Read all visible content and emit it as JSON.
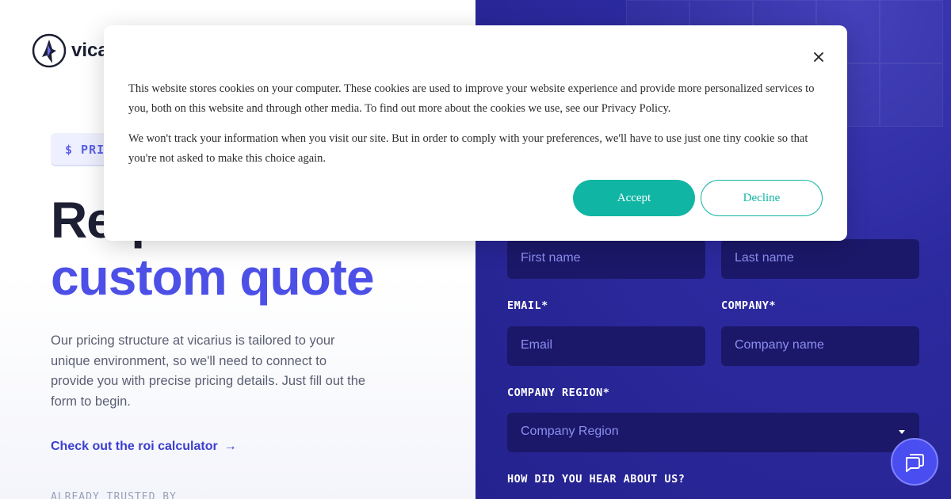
{
  "brand": {
    "logo_text": "vicarius"
  },
  "hero": {
    "pill_label": "$ PRICING",
    "title_line1": "Request a",
    "title_line2": "custom quote",
    "description": "Our pricing structure at vicarius is tailored to your unique environment, so we'll need to connect to provide you with precise pricing details. Just fill out the form to begin.",
    "roi_link": "Check out the roi calculator",
    "roi_arrow": "→",
    "trusted_label": "ALREADY TRUSTED BY"
  },
  "form": {
    "first_name_placeholder": "First name",
    "last_name_placeholder": "Last name",
    "email_label": "EMAIL*",
    "email_placeholder": "Email",
    "company_label": "COMPANY*",
    "company_placeholder": "Company name",
    "region_label": "COMPANY REGION*",
    "region_selected": "Company Region",
    "hear_label": "HOW DID YOU HEAR ABOUT US?"
  },
  "cookie": {
    "paragraph1": "This website stores cookies on your computer. These cookies are used to improve your website experience and provide more personalized services to you, both on this website and through other media. To find out more about the cookies we use, see our Privacy Policy.",
    "paragraph2": "We won't track your information when you visit our site. But in order to comply with your preferences, we'll have to use just one tiny cookie so that you're not asked to make this choice again.",
    "accept_label": "Accept",
    "decline_label": "Decline"
  },
  "colors": {
    "accent": "#4d50e6",
    "panel": "#2d2aa0",
    "field": "#1b1869",
    "cookie_accent": "#11b5a4"
  },
  "icons": [
    "wolf-logo-icon",
    "arrow-right-icon",
    "chevron-down-icon",
    "close-icon",
    "chat-icon"
  ]
}
